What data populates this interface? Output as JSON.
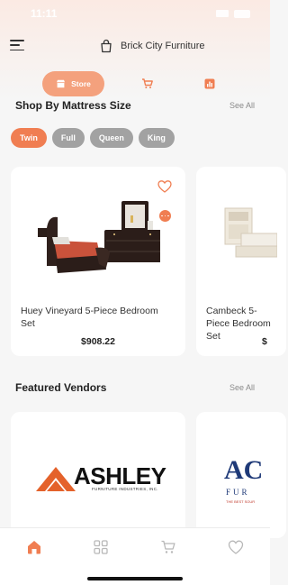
{
  "status_bar": {
    "time": "11:11"
  },
  "header": {
    "store_name": "Brick City Furniture"
  },
  "segments": {
    "store_label": "Store"
  },
  "mattress_section": {
    "title": "Shop By Mattress Size",
    "see_all": "See All",
    "sizes": [
      "Twin",
      "Full",
      "Queen",
      "King"
    ],
    "selected": "Twin"
  },
  "products": [
    {
      "name": "Huey Vineyard 5-Piece Bedroom Set",
      "price": "$908.22"
    },
    {
      "name": "Cambeck 5-Piece Bedroom Set",
      "price": "$"
    }
  ],
  "vendors_section": {
    "title": "Featured Vendors",
    "see_all": "See All",
    "vendors": [
      {
        "name": "ASHLEY",
        "tagline": "FURNITURE INDUSTRIES, INC."
      },
      {
        "name": "AC",
        "tagline": "FUR",
        "subtagline": "THE BEST SOUR"
      }
    ]
  },
  "colors": {
    "accent": "#f07e52",
    "accent_light": "#f4a17d",
    "chip_inactive": "#a2a2a2"
  },
  "icons": {
    "nav": [
      "home-icon",
      "grid-icon",
      "cart-icon",
      "heart-icon"
    ],
    "active_nav": "home-icon"
  }
}
